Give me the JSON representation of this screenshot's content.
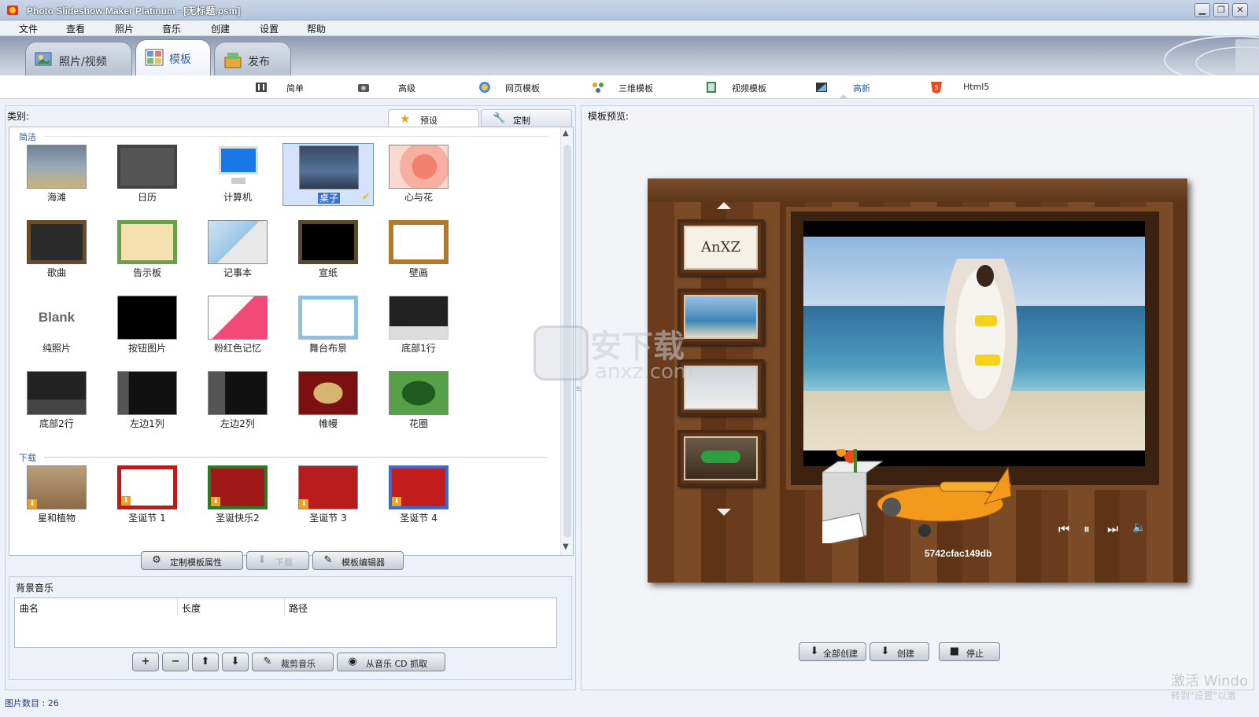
{
  "window": {
    "title": "Photo Slideshow Maker Platinum - [无标题.psm]",
    "buttons": {
      "minimize": "▁",
      "maximize": "❐",
      "close": "✕"
    }
  },
  "menu": [
    "文件",
    "查看",
    "照片",
    "音乐",
    "创建",
    "设置",
    "帮助"
  ],
  "main_tabs": [
    {
      "label": "照片/视频",
      "icon": "photo-video-icon"
    },
    {
      "label": "模板",
      "icon": "template-icon",
      "selected": true
    },
    {
      "label": "发布",
      "icon": "publish-icon"
    }
  ],
  "sub_tabs": [
    {
      "label": "简单",
      "icon": "simple-icon"
    },
    {
      "label": "高级",
      "icon": "advanced-icon"
    },
    {
      "label": "网页模板",
      "icon": "web-template-icon"
    },
    {
      "label": "三维模板",
      "icon": "3d-template-icon"
    },
    {
      "label": "视频模板",
      "icon": "video-template-icon"
    },
    {
      "label": "高新",
      "icon": "hd-icon",
      "selected": true
    },
    {
      "label": "Html5",
      "icon": "html5-icon"
    }
  ],
  "left_panel": {
    "category_label": "类别:",
    "tabs": [
      {
        "label": "预设",
        "icon": "star-icon",
        "selected": true
      },
      {
        "label": "定制",
        "icon": "wrench-icon"
      }
    ],
    "groups": [
      {
        "name": "简洁",
        "items": [
          "海滩",
          "日历",
          "计算机",
          "桌子",
          "心与花",
          "歌曲",
          "告示板",
          "记事本",
          "宣纸",
          "壁画",
          "纯照片",
          "按钮图片",
          "粉红色记忆",
          "舞台布景",
          "底部1行",
          "底部2行",
          "左边1列",
          "左边2列",
          "帷幔",
          "花圈"
        ],
        "selected": "桌子"
      },
      {
        "name": "下载",
        "items": [
          "星和植物",
          "圣诞节 1",
          "圣诞快乐2",
          "圣诞节 3",
          "圣诞节 4"
        ]
      }
    ],
    "blank_thumb_text": "Blank",
    "buttons": [
      {
        "label": "定制模板属性",
        "icon": "gear-icon"
      },
      {
        "label": "下载",
        "icon": "download-icon",
        "disabled": true
      },
      {
        "label": "模板编辑器",
        "icon": "pencil-icon"
      }
    ]
  },
  "bg_music": {
    "title": "背景音乐",
    "columns": [
      "曲名",
      "长度",
      "路径"
    ],
    "buttons": [
      {
        "label": "",
        "icon": "plus-icon",
        "glyph": "+"
      },
      {
        "label": "",
        "icon": "minus-icon",
        "glyph": "−"
      },
      {
        "label": "",
        "icon": "arrow-up-icon",
        "glyph": "⬆"
      },
      {
        "label": "",
        "icon": "arrow-down-icon",
        "glyph": "⬇"
      },
      {
        "label": "裁剪音乐",
        "icon": "pencil-icon",
        "glyph": "✎"
      },
      {
        "label": "从音乐 CD 抓取",
        "icon": "cd-icon",
        "glyph": "◉"
      }
    ]
  },
  "right_panel": {
    "title": "模板预览:",
    "preview_caption": "5742cfac149db",
    "thumb_text": "AnXZ",
    "player_controls": [
      "⏮",
      "⏸",
      "⏭",
      "🔈"
    ],
    "buttons": [
      {
        "label": "全部创建",
        "icon": "create-all-icon"
      },
      {
        "label": "创建",
        "icon": "create-icon"
      },
      {
        "label": "停止",
        "icon": "stop-icon"
      }
    ]
  },
  "status": {
    "photo_count": "图片数目 : 26"
  },
  "watermark": {
    "text": "安下载",
    "sub": "anxz.com"
  },
  "activation": {
    "line1": "激活 Windo",
    "line2": "转到\"设置\"以激"
  },
  "colors": {
    "accent": "#2a62b4",
    "selection": "#d4e2fb",
    "wood": "#6a3b1c"
  }
}
